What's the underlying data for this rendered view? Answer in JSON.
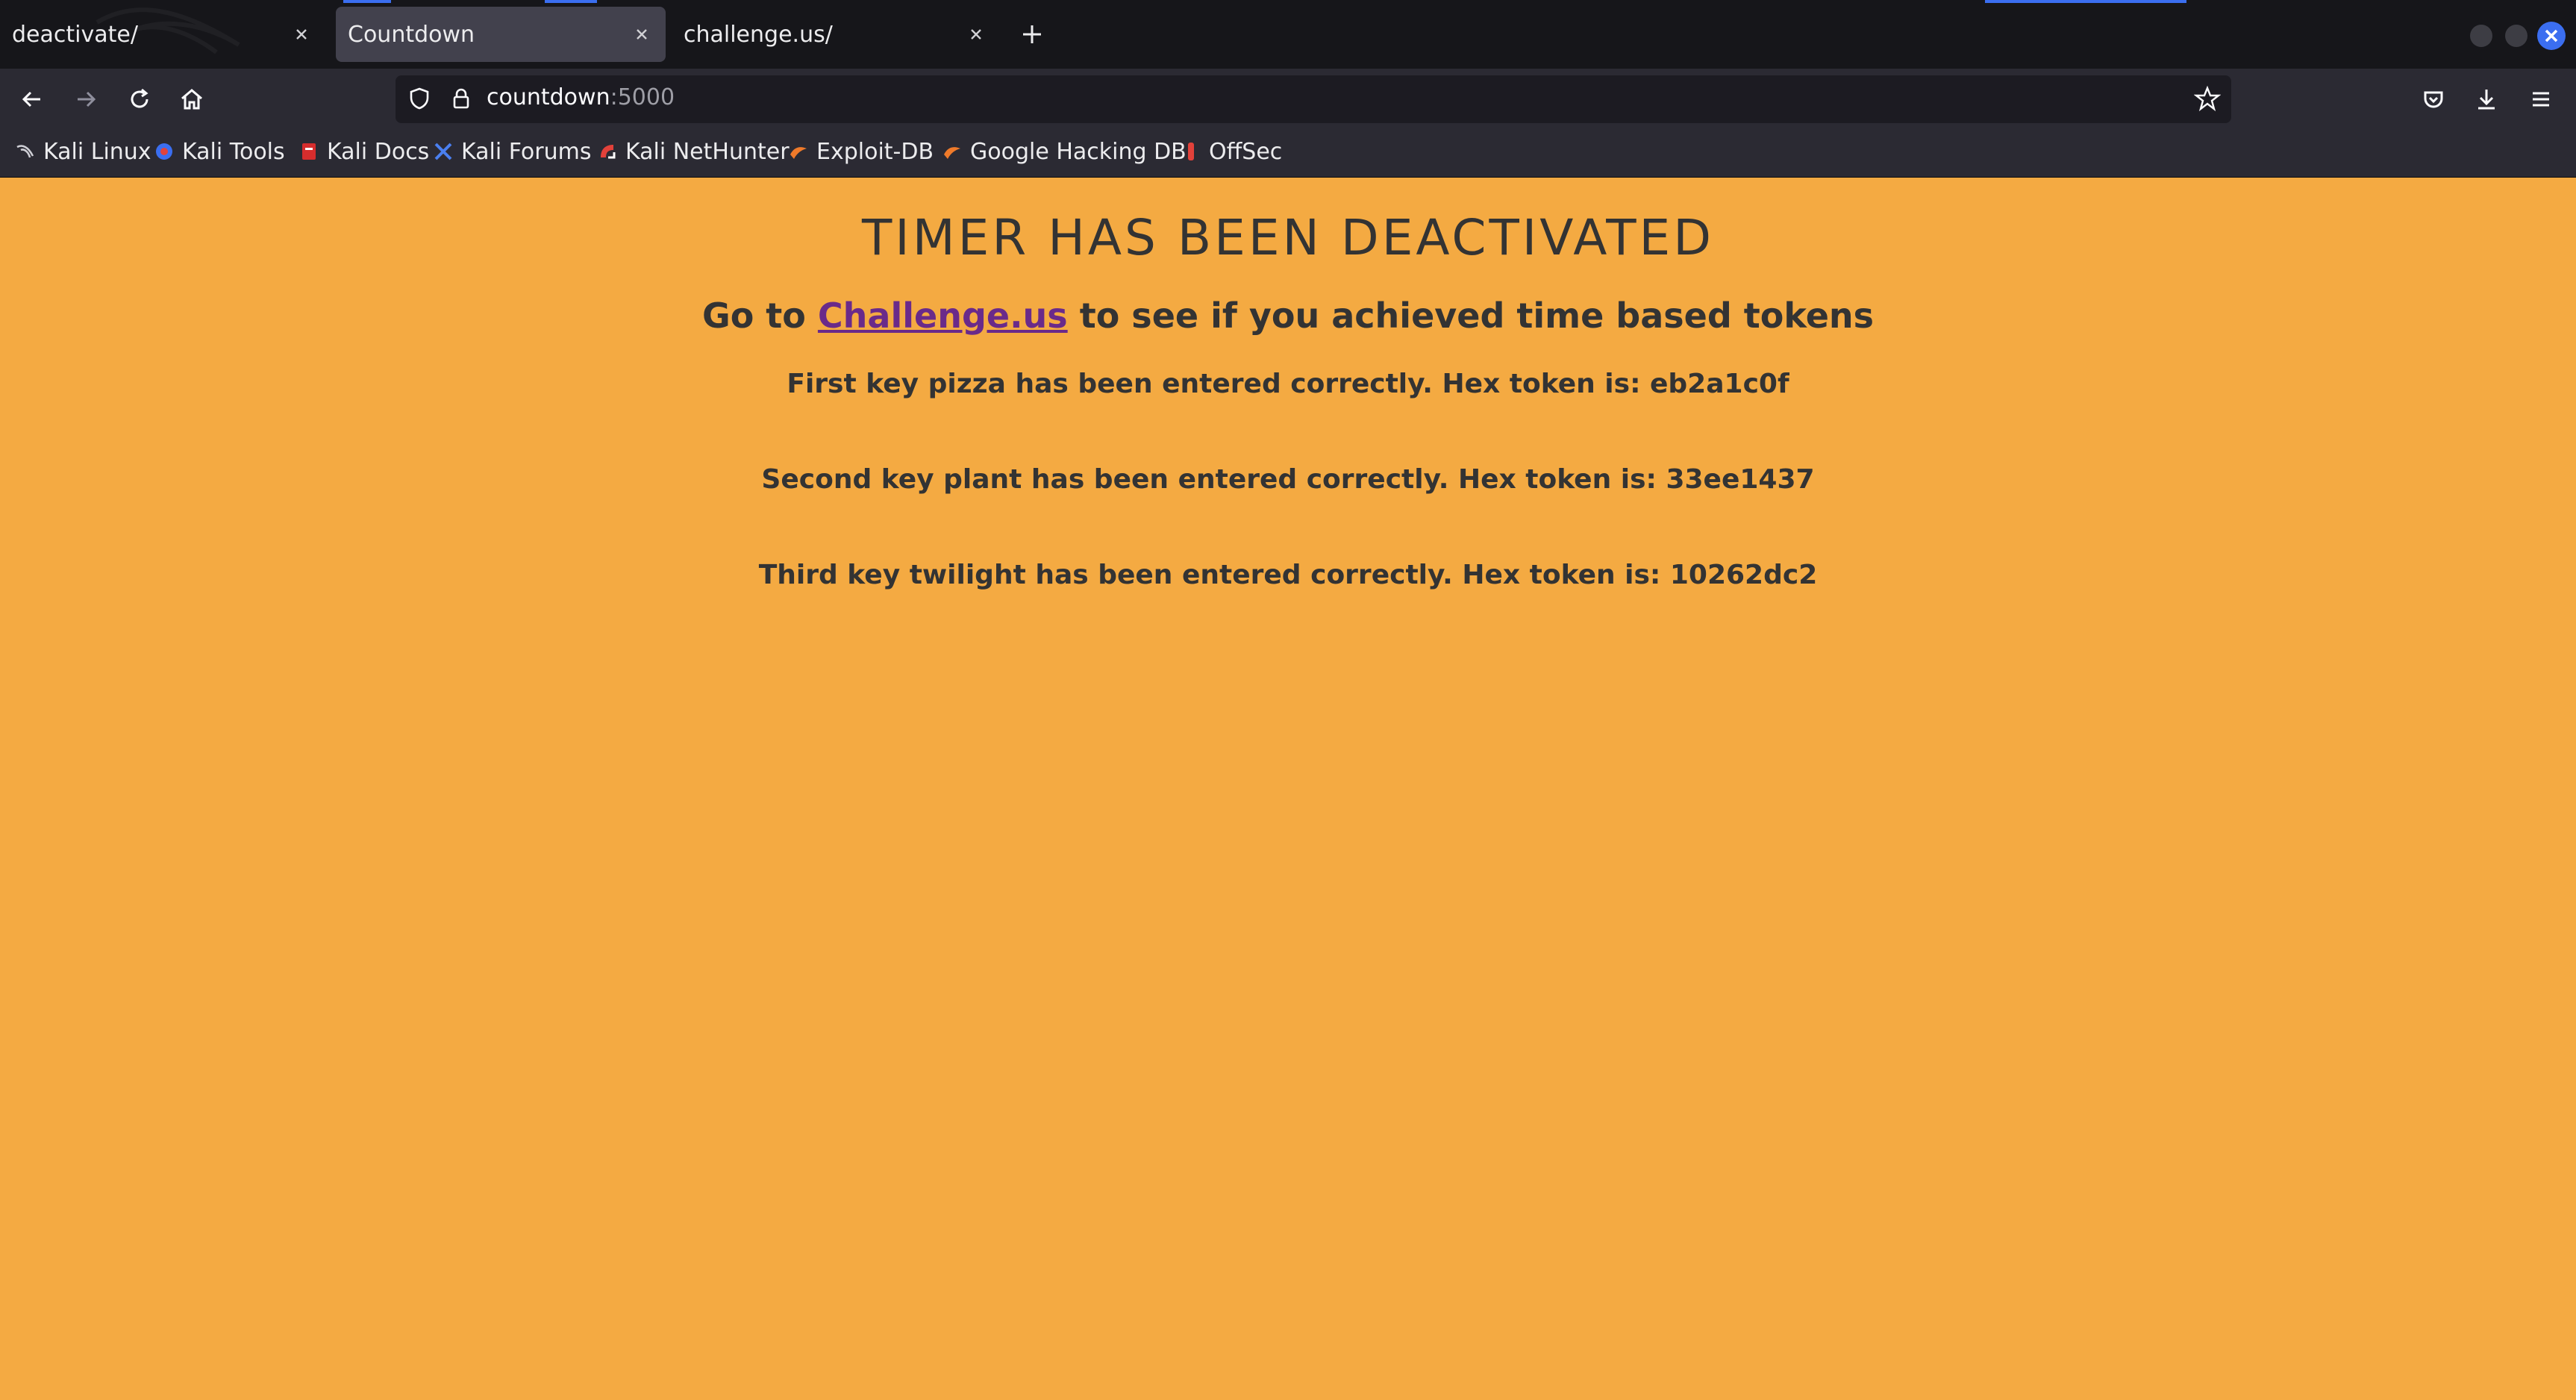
{
  "tabs": [
    {
      "title": "deactivate/",
      "active": false
    },
    {
      "title": "Countdown",
      "active": true
    },
    {
      "title": "challenge.us/",
      "active": false
    }
  ],
  "address_bar": {
    "host": "countdown",
    "port": ":5000"
  },
  "bookmarks": [
    {
      "label": "Kali Linux",
      "icon": "kali-dragon-icon"
    },
    {
      "label": "Kali Tools",
      "icon": "kali-tools-icon"
    },
    {
      "label": "Kali Docs",
      "icon": "kali-docs-icon"
    },
    {
      "label": "Kali Forums",
      "icon": "kali-forums-icon"
    },
    {
      "label": "Kali NetHunter",
      "icon": "nethunter-icon"
    },
    {
      "label": "Exploit-DB",
      "icon": "exploit-db-icon"
    },
    {
      "label": "Google Hacking DB",
      "icon": "ghdb-icon"
    },
    {
      "label": "OffSec",
      "icon": "offsec-icon"
    }
  ],
  "page": {
    "title": "TIMER HAS BEEN DEACTIVATED",
    "subtitle_prefix": "Go to",
    "subtitle_link": "Challenge.us",
    "subtitle_suffix": "to see if you achieved time based tokens",
    "tokens": [
      "First key pizza has been entered correctly. Hex token is: eb2a1c0f",
      "Second key plant has been entered correctly. Hex token is: 33ee1437",
      "Third key twilight has been entered correctly. Hex token is: 10262dc2"
    ]
  },
  "colors": {
    "page_background": "#f4aa42",
    "text": "#333333",
    "link": "#6a2a8a",
    "toolbar": "#2b2a33",
    "tabstrip": "#16161a",
    "accent": "#3b6ef0"
  }
}
